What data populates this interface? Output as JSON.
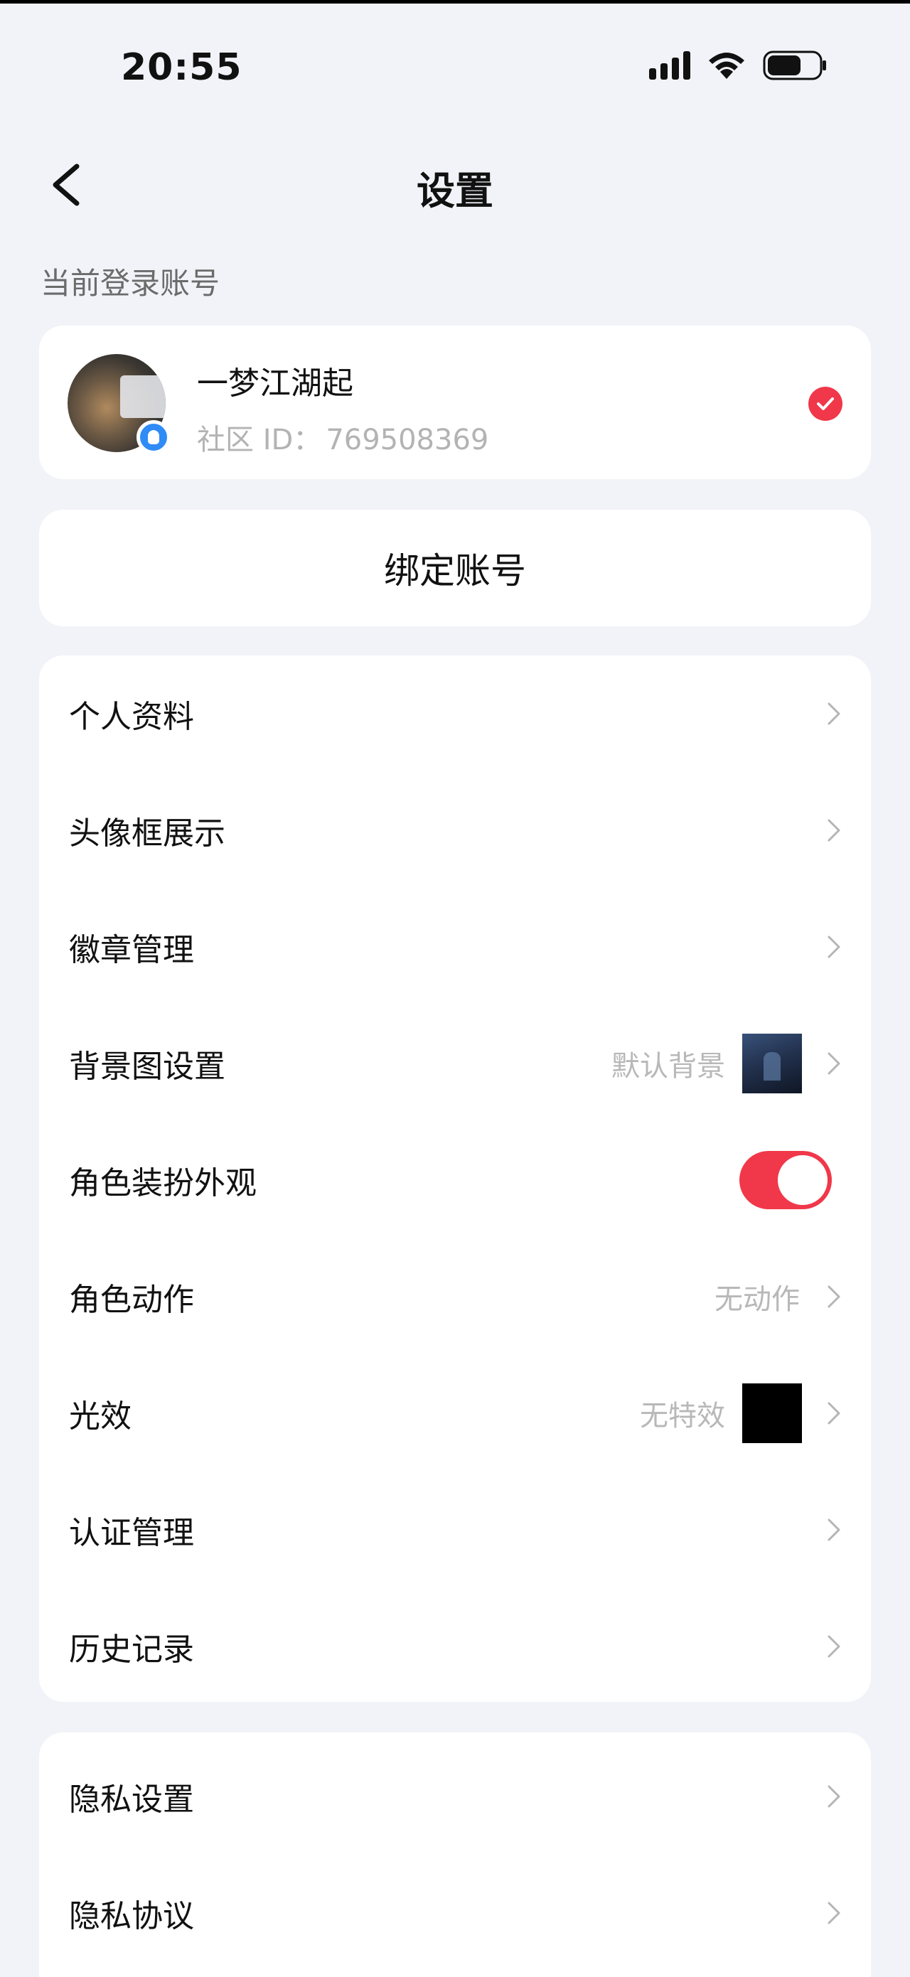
{
  "status_bar": {
    "time": "20:55"
  },
  "nav": {
    "title": "设置"
  },
  "section": {
    "current_account_label": "当前登录账号"
  },
  "account": {
    "name": "一梦江湖起",
    "id_label": "社区 ID：",
    "id_value": "769508369"
  },
  "bind": {
    "label": "绑定账号"
  },
  "menu": {
    "items": [
      {
        "label": "个人资料"
      },
      {
        "label": "头像框展示"
      },
      {
        "label": "徽章管理"
      },
      {
        "label": "背景图设置",
        "value": "默认背景"
      },
      {
        "label": "角色装扮外观",
        "toggle_on": true
      },
      {
        "label": "角色动作",
        "value": "无动作"
      },
      {
        "label": "光效",
        "value": "无特效"
      },
      {
        "label": "认证管理"
      },
      {
        "label": "历史记录"
      }
    ]
  },
  "menu2": {
    "items": [
      {
        "label": "隐私设置"
      },
      {
        "label": "隐私协议"
      }
    ]
  },
  "colors": {
    "accent": "#f0384a",
    "background": "#f2f3f8",
    "qq_badge": "#2f8bf5"
  },
  "icons": [
    "back-arrow-icon",
    "signal-icon",
    "wifi-icon",
    "battery-icon",
    "check-icon",
    "chevron-right-icon",
    "qq-icon"
  ]
}
